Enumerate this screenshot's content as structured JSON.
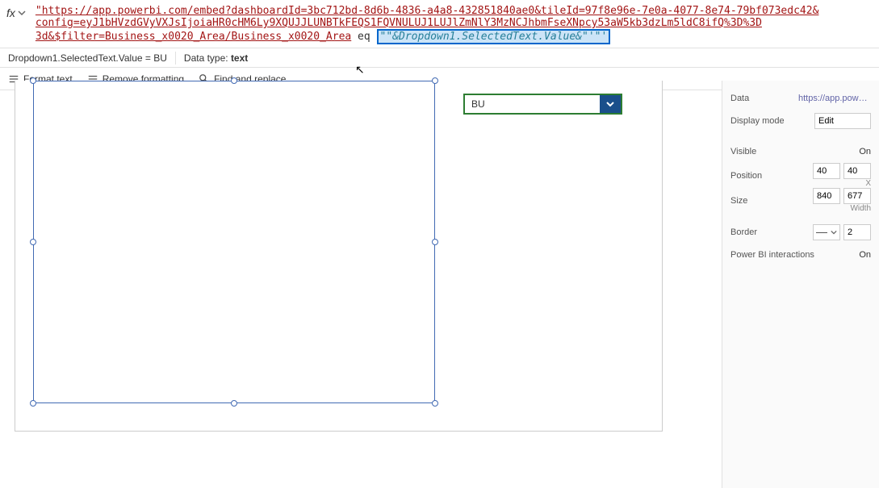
{
  "formulaBar": {
    "fx": "fx",
    "line1": "\"https://app.powerbi.com/embed?dashboardId=3bc712bd-8d6b-4836-a4a8-432851840ae0&tileId=97f8e96e-7e0a-4077-8e74-79bf073edc42&",
    "line2": "config=eyJ1bHVzdGVyVXJsIjoiaHR0cHM6Ly9XQUJJLUNBTkFEQS1FQVNULUJ1LUJlZmNlY3MzNCJhbmFseXNpcy53aW5kb3dzLm5ldC8ifQ%3D%3D",
    "line3_pre": "3d&$filter=Business_x0020_Area/Business_x0020_Area",
    "line3_eq": " eq ",
    "highlighted": "\"\"&Dropdown1.SelectedText.Value&\"'\"'"
  },
  "statusBar": {
    "expr": "Dropdown1.SelectedText.Value  =  BU",
    "typeLabel": "Data type: ",
    "typeValue": "text"
  },
  "toolbar": {
    "formatText": "Format text",
    "removeFormatting": "Remove formatting",
    "findReplace": "Find and replace"
  },
  "dropdown": {
    "value": "BU"
  },
  "props": {
    "data": {
      "label": "Data",
      "value": "https://app.powerbi."
    },
    "displayMode": {
      "label": "Display mode",
      "value": "Edit"
    },
    "visible": {
      "label": "Visible",
      "value": "On"
    },
    "position": {
      "label": "Position",
      "x": "40",
      "y": "40",
      "xlabel": "X"
    },
    "size": {
      "label": "Size",
      "w": "840",
      "h": "677",
      "wlabel": "Width"
    },
    "border": {
      "label": "Border",
      "value": "2"
    },
    "pbi": {
      "label": "Power BI interactions",
      "value": "On"
    }
  }
}
